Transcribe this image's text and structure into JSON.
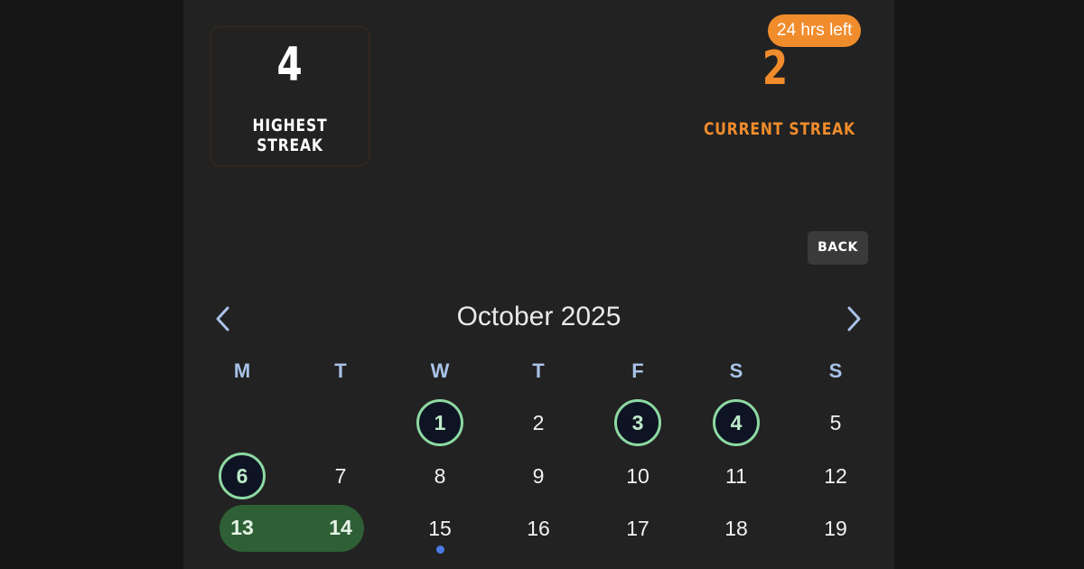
{
  "streaks": {
    "highest_value": "4",
    "highest_label": "HIGHEST STREAK",
    "current_value": "2",
    "current_label": "CURRENT STREAK",
    "time_left_badge": "24 hrs left"
  },
  "back_label": "BACK",
  "calendar": {
    "month_title": "October 2025",
    "weekdays": [
      "M",
      "T",
      "W",
      "T",
      "F",
      "S",
      "S"
    ],
    "week1": [
      "",
      "",
      "1",
      "2",
      "3",
      "4",
      "5"
    ],
    "week2": [
      "6",
      "7",
      "8",
      "9",
      "10",
      "11",
      "12"
    ],
    "week3": [
      "13",
      "14",
      "15",
      "16",
      "17",
      "18",
      "19"
    ],
    "completed_days": [
      "1",
      "3",
      "4",
      "6"
    ],
    "streak_range": [
      "13",
      "14"
    ],
    "today": "15"
  },
  "colors": {
    "accent": "#f08c2c",
    "ring": "#8dd9a2",
    "range_fill": "#2f5f35",
    "today_dot": "#4c7be8",
    "weekday": "#a9c2e8"
  },
  "icons": {
    "prev": "chevron-left-icon",
    "next": "chevron-right-icon"
  }
}
